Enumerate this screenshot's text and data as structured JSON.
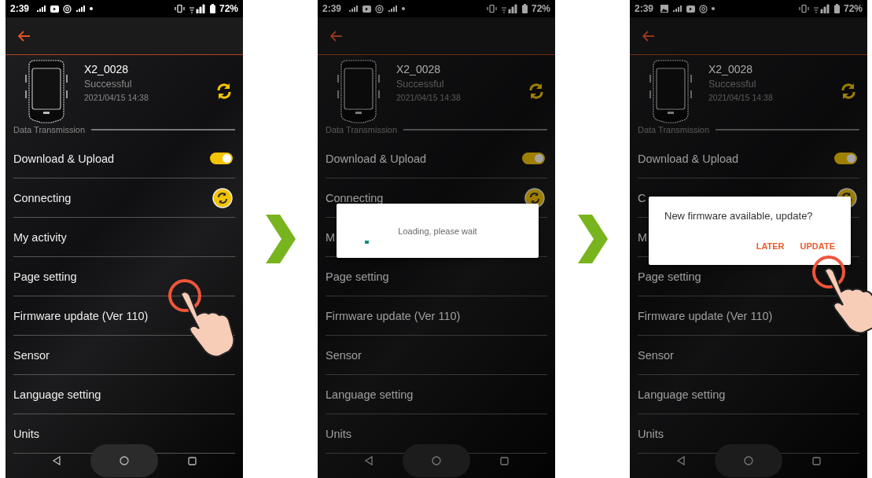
{
  "screens": [
    {
      "status_bar": {
        "time": "2:39",
        "notifications": [
          {
            "kind": "signal"
          },
          {
            "kind": "video"
          },
          {
            "kind": "at"
          },
          {
            "kind": "signal"
          },
          {
            "kind": "dot"
          }
        ],
        "battery": "72%"
      },
      "device": {
        "name": "X2_0028",
        "status": "Successful",
        "date": "2021/04/15 14:38"
      },
      "section_label": "Data Transmission",
      "rows": [
        {
          "label": "Download & Upload",
          "kind": "toggle",
          "on": true
        },
        {
          "label": "Connecting",
          "kind": "sync"
        },
        {
          "label": "My activity",
          "kind": "plain"
        },
        {
          "label": "Page setting",
          "kind": "plain"
        },
        {
          "label": "Firmware update (Ver 110)",
          "kind": "plain"
        },
        {
          "label": "Sensor",
          "kind": "plain"
        },
        {
          "label": "Language setting",
          "kind": "plain"
        },
        {
          "label": "Units",
          "kind": "plain"
        }
      ],
      "touch": {
        "kind": "row"
      }
    },
    {
      "status_bar": {
        "time": "2:39",
        "notifications": [
          {
            "kind": "signal"
          },
          {
            "kind": "video"
          },
          {
            "kind": "at"
          },
          {
            "kind": "signal"
          },
          {
            "kind": "dot"
          }
        ],
        "battery": "72%"
      },
      "device": {
        "name": "X2_0028",
        "status": "Successful",
        "date": "2021/04/15 14:38"
      },
      "section_label": "Data Transmission",
      "rows": [
        {
          "label": "Download & Upload",
          "kind": "toggle",
          "on": true
        },
        {
          "label": "Connecting",
          "kind": "sync"
        },
        {
          "label": "M",
          "kind": "plain"
        },
        {
          "label": "Page setting",
          "kind": "plain"
        },
        {
          "label": "Firmware update (Ver 110)",
          "kind": "plain"
        },
        {
          "label": "Sensor",
          "kind": "plain"
        },
        {
          "label": "Language setting",
          "kind": "plain"
        },
        {
          "label": "Units",
          "kind": "plain"
        }
      ],
      "dimmed": true,
      "dialog": {
        "kind": "loading",
        "message": "Loading, please wait"
      }
    },
    {
      "status_bar": {
        "time": "2:39",
        "notifications": [
          {
            "kind": "image"
          },
          {
            "kind": "signal"
          },
          {
            "kind": "video"
          },
          {
            "kind": "at"
          },
          {
            "kind": "dot"
          }
        ],
        "battery": "72%"
      },
      "device": {
        "name": "X2_0028",
        "status": "Successful",
        "date": "2021/04/15 14:38"
      },
      "section_label": "Data Transmission",
      "rows": [
        {
          "label": "Download & Upload",
          "kind": "toggle",
          "on": true
        },
        {
          "label": "C",
          "kind": "sync"
        },
        {
          "label": "M",
          "kind": "plain"
        },
        {
          "label": "Page setting",
          "kind": "plain"
        },
        {
          "label": "Firmware update (Ver 110)",
          "kind": "plain"
        },
        {
          "label": "Sensor",
          "kind": "plain"
        },
        {
          "label": "Language setting",
          "kind": "plain"
        },
        {
          "label": "Units",
          "kind": "plain"
        }
      ],
      "dimmed": true,
      "dialog": {
        "kind": "confirm",
        "message": "New firmware available, update?",
        "buttons": [
          "LATER",
          "UPDATE"
        ]
      },
      "touch": {
        "kind": "button"
      }
    }
  ]
}
